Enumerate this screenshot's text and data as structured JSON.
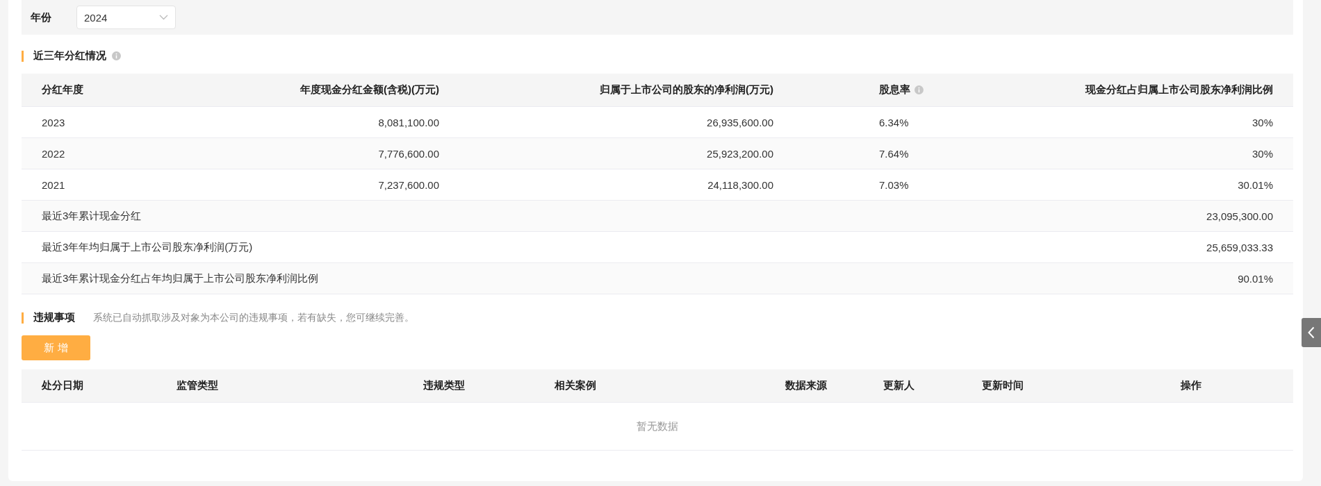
{
  "filter": {
    "label": "年份",
    "value": "2024"
  },
  "dividend": {
    "title": "近三年分红情况",
    "columns": [
      {
        "label": "分红年度",
        "info": false
      },
      {
        "label": "年度现金分红金额(含税)(万元)",
        "info": false
      },
      {
        "label": "归属于上市公司的股东的净利润(万元)",
        "info": false
      },
      {
        "label": "股息率",
        "info": true
      },
      {
        "label": "现金分红占归属上市公司股东净利润比例",
        "info": false
      }
    ],
    "rows": [
      [
        "2023",
        "8,081,100.00",
        "26,935,600.00",
        "6.34%",
        "30%"
      ],
      [
        "2022",
        "7,776,600.00",
        "25,923,200.00",
        "7.64%",
        "30%"
      ],
      [
        "2021",
        "7,237,600.00",
        "24,118,300.00",
        "7.03%",
        "30.01%"
      ]
    ],
    "summary": [
      {
        "label": "最近3年累计现金分红",
        "value": "23,095,300.00"
      },
      {
        "label": "最近3年年均归属于上市公司股东净利润(万元)",
        "value": "25,659,033.33"
      },
      {
        "label": "最近3年累计现金分红占年均归属于上市公司股东净利润比例",
        "value": "90.01%"
      }
    ]
  },
  "violations": {
    "title": "违规事项",
    "note": "系统已自动抓取涉及对象为本公司的违规事项，若有缺失，您可继续完善。",
    "add_button": "新 增",
    "columns": [
      "处分日期",
      "监管类型",
      "违规类型",
      "相关案例",
      "数据来源",
      "更新人",
      "更新时间",
      "操作"
    ],
    "empty_text": "暂无数据"
  }
}
